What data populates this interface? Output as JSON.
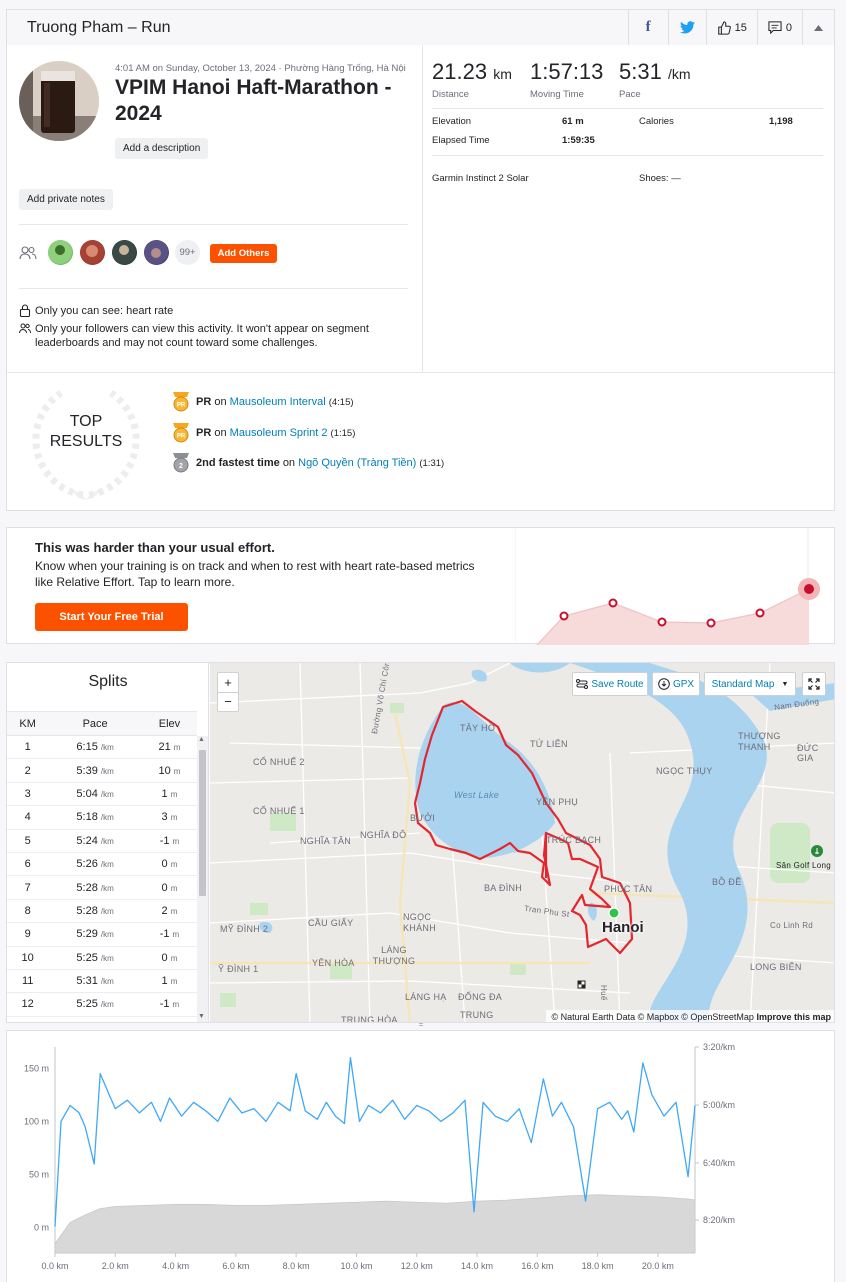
{
  "header": {
    "title": "Truong Pham – Run",
    "likes": "15",
    "comments": "0"
  },
  "activity": {
    "meta": "4:01 AM on Sunday, October 13, 2024 · Phường Hàng Trống, Hà Nội",
    "title": "VPIM Hanoi Haft-Marathon - 2024",
    "add_description": "Add a description",
    "add_private_notes": "Add private notes",
    "more_count": "99+",
    "add_others": "Add Others",
    "privacy_heart": "Only you can see: heart rate",
    "privacy_followers": "Only your followers can view this activity. It won't appear on segment leaderboards and may not count toward some challenges."
  },
  "stats": {
    "distance": {
      "value": "21.23",
      "unit": "km",
      "label": "Distance"
    },
    "moving_time": {
      "value": "1:57:13",
      "label": "Moving Time"
    },
    "pace": {
      "value": "5:31",
      "unit": "/km",
      "label": "Pace"
    },
    "elevation_label": "Elevation",
    "elevation_value": "61 m",
    "calories_label": "Calories",
    "calories_value": "1,198",
    "elapsed_label": "Elapsed Time",
    "elapsed_value": "1:59:35",
    "device": "Garmin Instinct 2 Solar",
    "shoes": "Shoes: —"
  },
  "top_results": {
    "heading_line1": "TOP",
    "heading_line2": "RESULTS",
    "items": [
      {
        "badge": "PR",
        "label": "PR",
        "on": "on",
        "segment": "Mausoleum Interval",
        "time": "(4:15)"
      },
      {
        "badge": "PR",
        "label": "PR",
        "on": "on",
        "segment": "Mausoleum Sprint 2",
        "time": "(1:15)"
      },
      {
        "badge": "2",
        "label": "2nd fastest time",
        "on": "on",
        "segment": "Ngõ Quyền (Tràng Tiền)",
        "time": "(1:31)"
      }
    ]
  },
  "upsell": {
    "title": "This was harder than your usual effort.",
    "body": "Know when your training is on track and when to rest with heart rate-based metrics like Relative Effort. Tap to learn more.",
    "cta": "Start Your Free Trial"
  },
  "splits": {
    "title": "Splits",
    "columns": [
      "KM",
      "Pace",
      "Elev"
    ],
    "pace_unit": "/km",
    "elev_unit": "m",
    "rows": [
      {
        "km": "1",
        "pace": "6:15",
        "elev": "21"
      },
      {
        "km": "2",
        "pace": "5:39",
        "elev": "10"
      },
      {
        "km": "3",
        "pace": "5:04",
        "elev": "1"
      },
      {
        "km": "4",
        "pace": "5:18",
        "elev": "3"
      },
      {
        "km": "5",
        "pace": "5:24",
        "elev": "-1"
      },
      {
        "km": "6",
        "pace": "5:26",
        "elev": "0"
      },
      {
        "km": "7",
        "pace": "5:28",
        "elev": "0"
      },
      {
        "km": "8",
        "pace": "5:28",
        "elev": "2"
      },
      {
        "km": "9",
        "pace": "5:29",
        "elev": "-1"
      },
      {
        "km": "10",
        "pace": "5:25",
        "elev": "0"
      },
      {
        "km": "11",
        "pace": "5:31",
        "elev": "1"
      },
      {
        "km": "12",
        "pace": "5:25",
        "elev": "-1"
      }
    ]
  },
  "map": {
    "zoom_in": "+",
    "zoom_out": "−",
    "save_route": "Save Route",
    "gpx": "GPX",
    "style": "Standard Map",
    "city": "Hanoi",
    "attribution": "© Natural Earth Data © Mapbox © OpenStreetMap",
    "improve": "Improve this map",
    "labels": [
      {
        "id": "tay-ho",
        "text": "TÂY HỒ"
      },
      {
        "id": "tu-lien",
        "text": "TỨ LIÊN"
      },
      {
        "id": "yen-phu",
        "text": "YÊN PHỤ"
      },
      {
        "id": "truc-bach",
        "text": "TRÚC BẠCH"
      },
      {
        "id": "west-lake",
        "text": "West Lake"
      },
      {
        "id": "buoi",
        "text": "BƯỞI"
      },
      {
        "id": "co-nhue-2",
        "text": "CỔ NHUẾ 2"
      },
      {
        "id": "co-nhue-1",
        "text": "CỔ NHUẾ 1"
      },
      {
        "id": "nghia-tan",
        "text": "NGHĨA TÂN"
      },
      {
        "id": "nghia-do",
        "text": "NGHĨA ĐÔ"
      },
      {
        "id": "ba-dinh",
        "text": "BA ĐÌNH"
      },
      {
        "id": "phuc-tan",
        "text": "PHÚC TÂN"
      },
      {
        "id": "ngoc-thuy",
        "text": "NGỌC THỤY"
      },
      {
        "id": "thuong-thanh",
        "text": "THƯỢNG THANH"
      },
      {
        "id": "duc-gia",
        "text": "ĐỨC GIA"
      },
      {
        "id": "bo-de",
        "text": "BỒ ĐỀ"
      },
      {
        "id": "long-bien",
        "text": "LONG BIÊN"
      },
      {
        "id": "ngoc-khanh",
        "text": "NGỌC KHÁNH"
      },
      {
        "id": "cau-giay",
        "text": "CẦU GIẤY"
      },
      {
        "id": "my-dinh-2",
        "text": "MỸ ĐÌNH 2"
      },
      {
        "id": "my-dinh-1",
        "text": "Ỹ ĐÌNH 1"
      },
      {
        "id": "yen-hoa",
        "text": "YÊN HÒA"
      },
      {
        "id": "lang-thuong",
        "text": "LÁNG THƯỢNG"
      },
      {
        "id": "lang-ha",
        "text": "LÁNG HẠ"
      },
      {
        "id": "dong-da",
        "text": "ĐỐNG ĐA"
      },
      {
        "id": "trung-hoa",
        "text": "TRUNG HÒA"
      },
      {
        "id": "trung",
        "text": "TRUNG"
      },
      {
        "id": "nam-duong",
        "text": "Nam Đuống"
      },
      {
        "id": "duong-vo-chi-cong",
        "text": "Đường Võ Chí Công"
      },
      {
        "id": "tran-phu",
        "text": "Tran Phu St"
      },
      {
        "id": "hue",
        "text": "Huế"
      },
      {
        "id": "san-golf",
        "text": "Sân Golf Long"
      },
      {
        "id": "co-linh",
        "text": "Co Linh Rd"
      }
    ]
  },
  "chart_data": {
    "type": "line",
    "x_ticks": [
      "0.0 km",
      "2.0 km",
      "4.0 km",
      "6.0 km",
      "8.0 km",
      "10.0 km",
      "12.0 km",
      "14.0 km",
      "16.0 km",
      "18.0 km",
      "20.0 km"
    ],
    "elevation_ticks": [
      "150 m",
      "100 m",
      "50 m",
      "0 m"
    ],
    "pace_ticks": [
      "3:20/km",
      "5:00/km",
      "6:40/km",
      "8:20/km"
    ],
    "xlim": [
      0,
      21.23
    ],
    "elevation_ylim": [
      -20,
      170
    ],
    "series": [
      {
        "series_type": "pace",
        "color": "#3fa9f5",
        "x": [
          0,
          0.2,
          0.5,
          0.8,
          1.0,
          1.3,
          1.5,
          1.8,
          2.0,
          2.4,
          2.8,
          3.2,
          3.5,
          3.8,
          4.2,
          4.6,
          5.0,
          5.4,
          5.8,
          6.2,
          6.6,
          7.0,
          7.4,
          7.8,
          8.0,
          8.3,
          8.7,
          9.0,
          9.3,
          9.6,
          9.8,
          10.1,
          10.4,
          10.8,
          11.2,
          11.6,
          12.0,
          12.4,
          12.8,
          13.2,
          13.6,
          13.9,
          14.2,
          14.6,
          15.0,
          15.4,
          15.8,
          16.2,
          16.5,
          16.8,
          17.2,
          17.6,
          18.0,
          18.4,
          18.8,
          19.0,
          19.2,
          19.5,
          19.8,
          20.2,
          20.6,
          21.0,
          21.23
        ],
        "y": [
          1.0,
          100,
          115,
          108,
          95,
          60,
          145,
          125,
          112,
          120,
          108,
          118,
          100,
          122,
          105,
          118,
          110,
          100,
          122,
          108,
          112,
          100,
          118,
          110,
          145,
          110,
          102,
          118,
          105,
          98,
          160,
          100,
          115,
          108,
          120,
          102,
          115,
          110,
          100,
          108,
          120,
          15,
          118,
          105,
          100,
          112,
          80,
          140,
          105,
          118,
          95,
          25,
          112,
          118,
          102,
          110,
          90,
          155,
          125,
          105,
          118,
          48,
          115
        ]
      },
      {
        "series_type": "elevation",
        "color": "#d8d8d8",
        "x": [
          0,
          0.5,
          1.0,
          1.5,
          2.0,
          3.0,
          4.0,
          5.0,
          6.0,
          7.0,
          8.0,
          9.0,
          10.0,
          11.0,
          12.0,
          13.0,
          14.0,
          15.0,
          16.0,
          17.0,
          18.0,
          19.0,
          20.0,
          21.0,
          21.23
        ],
        "y": [
          -15,
          5,
          12,
          18,
          20,
          21,
          22,
          22,
          21,
          21,
          22,
          23,
          24,
          25,
          24,
          23,
          25,
          26,
          28,
          30,
          31,
          30,
          29,
          27,
          26
        ]
      }
    ]
  }
}
